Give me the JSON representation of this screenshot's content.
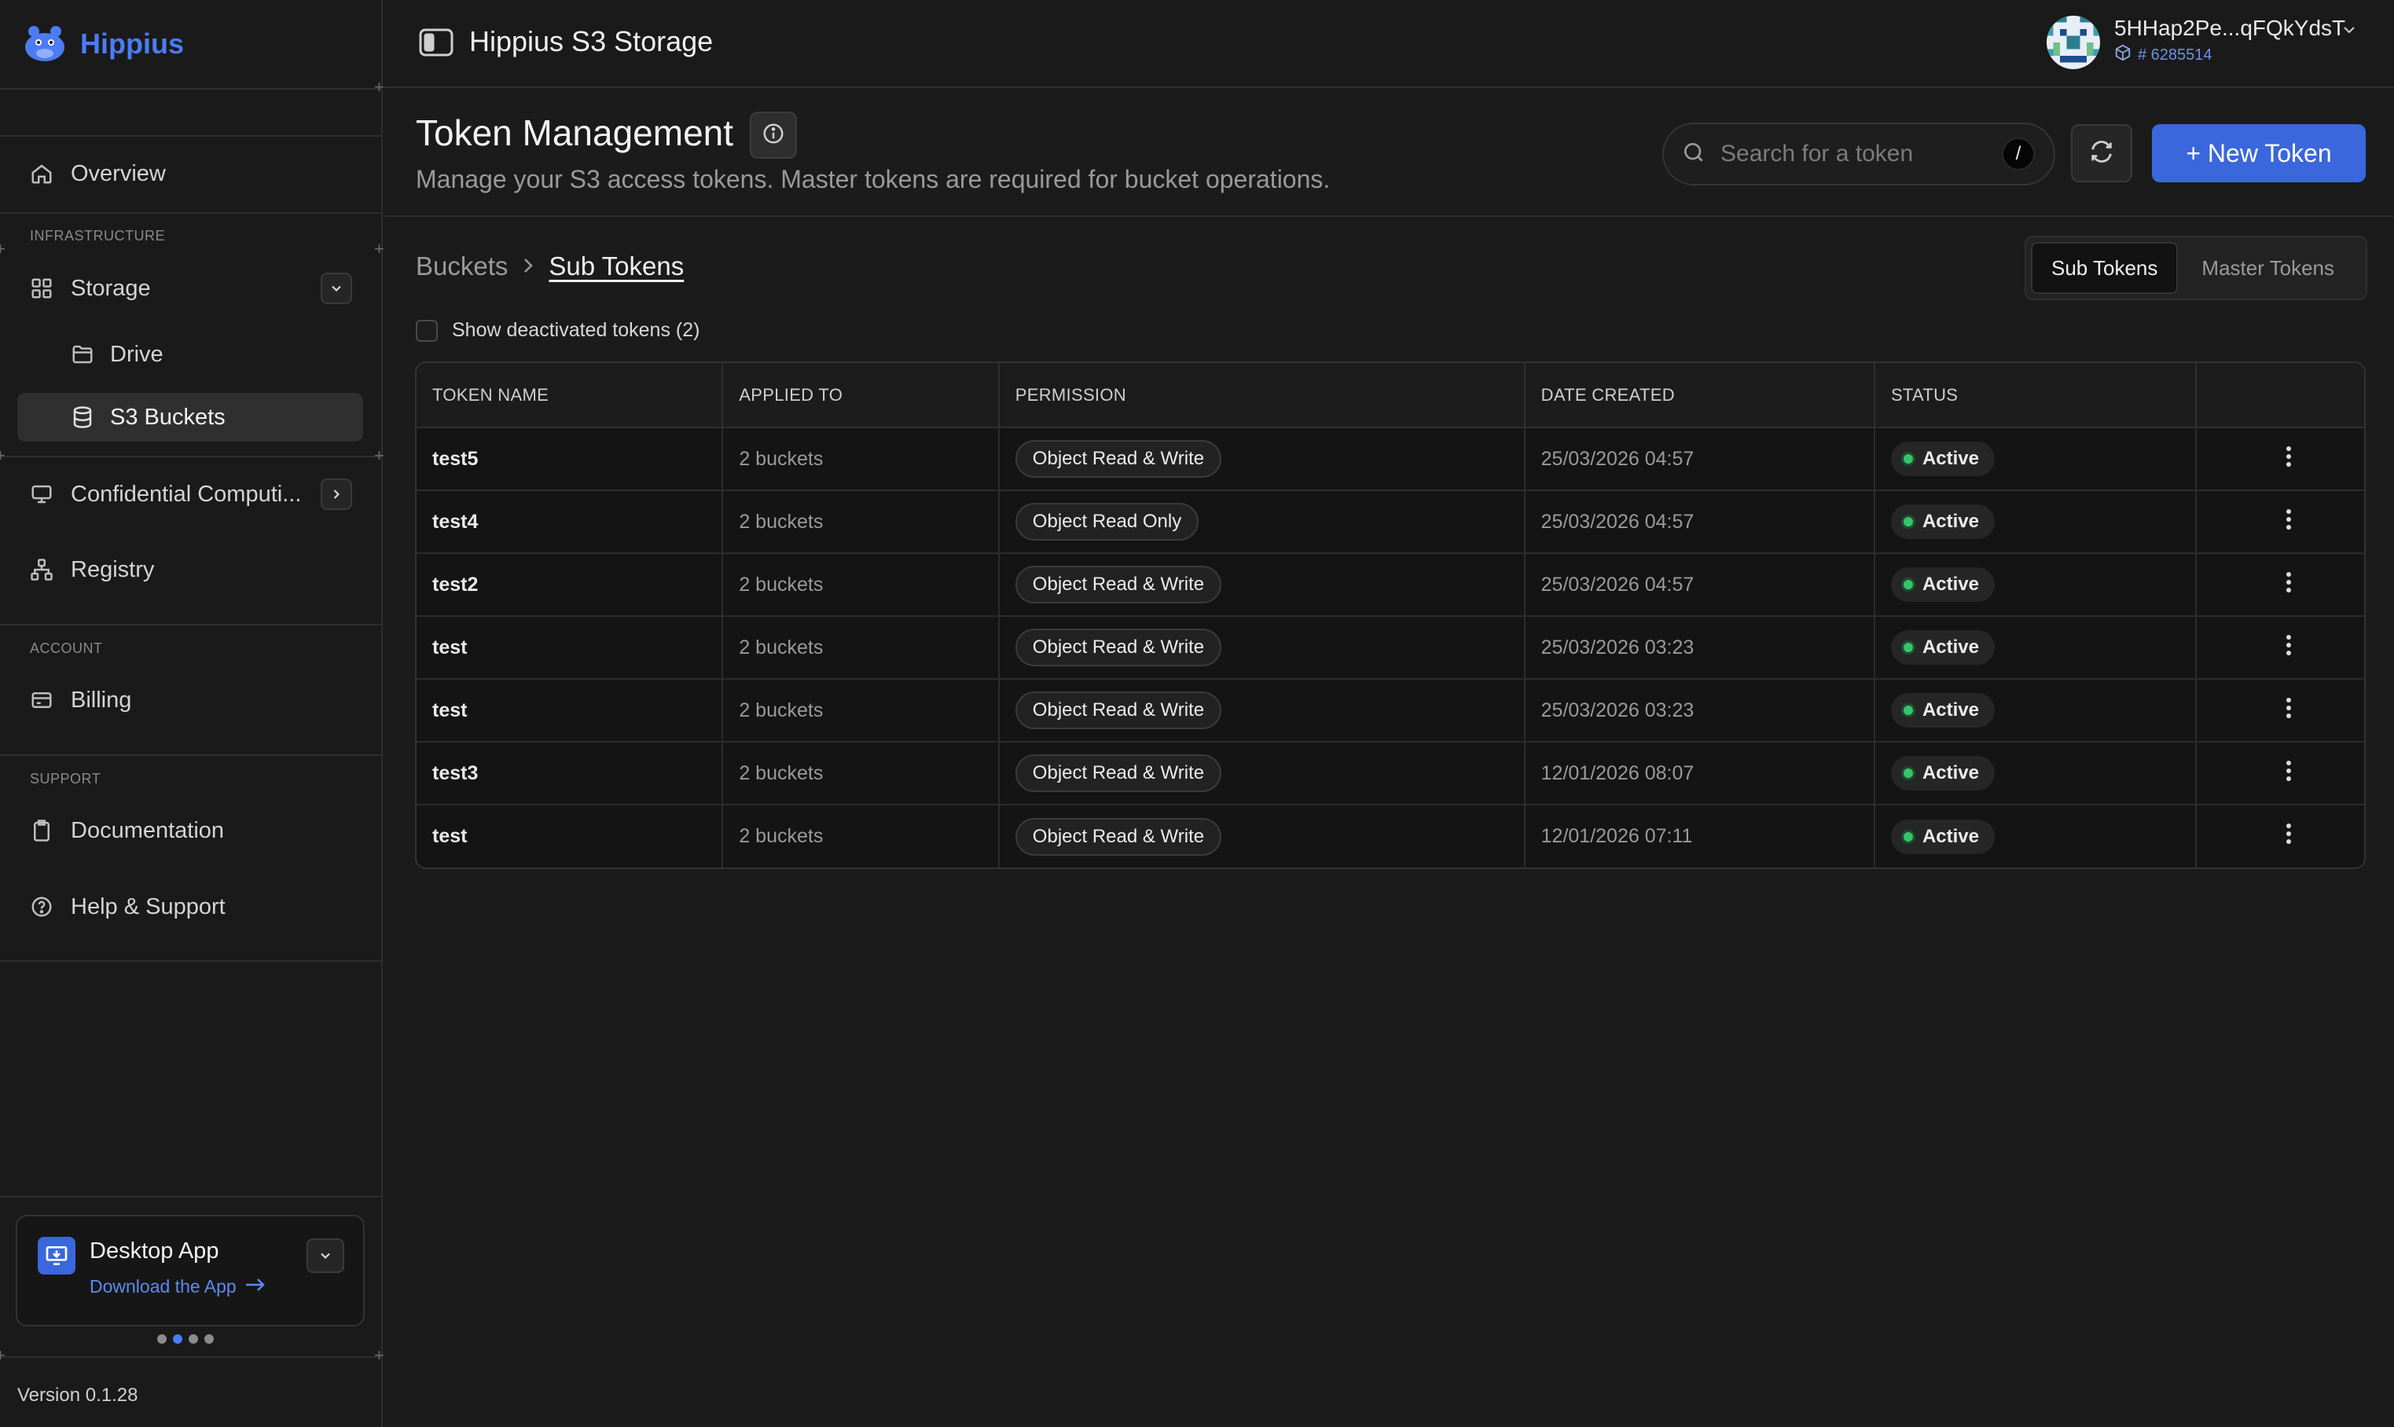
{
  "brand": {
    "name": "Hippius"
  },
  "sidebar": {
    "overview": "Overview",
    "sections": {
      "infrastructure": "INFRASTRUCTURE",
      "account": "ACCOUNT",
      "support": "SUPPORT"
    },
    "items": {
      "storage": "Storage",
      "drive": "Drive",
      "s3_buckets": "S3 Buckets",
      "confidential": "Confidential Computi...",
      "registry": "Registry",
      "billing": "Billing",
      "documentation": "Documentation",
      "help": "Help & Support"
    },
    "desktop_card": {
      "title": "Desktop App",
      "link": "Download the App"
    },
    "carousel": {
      "count": 4,
      "active_index": 1
    },
    "version": "Version 0.1.28"
  },
  "topbar": {
    "title": "Hippius S3 Storage",
    "user": {
      "address": "5HHap2Pe...qFQkYdsT",
      "id": "# 6285514"
    }
  },
  "header": {
    "title": "Token Management",
    "subtitle": "Manage your S3 access tokens. Master tokens are required for bucket operations.",
    "search_placeholder": "Search for a token",
    "search_shortcut": "/",
    "new_button": "+ New Token"
  },
  "breadcrumb": {
    "parent": "Buckets",
    "current": "Sub Tokens"
  },
  "tabs": {
    "sub": "Sub Tokens",
    "master": "Master Tokens",
    "active": "sub"
  },
  "filters": {
    "show_deactivated": "Show deactivated tokens (2)",
    "checked": false
  },
  "table": {
    "columns": {
      "name": "TOKEN NAME",
      "applied": "APPLIED TO",
      "permission": "PERMISSION",
      "date": "DATE CREATED",
      "status": "STATUS"
    },
    "rows": [
      {
        "name": "test5",
        "applied": "2 buckets",
        "permission": "Object Read & Write",
        "date": "25/03/2026 04:57",
        "status": "Active"
      },
      {
        "name": "test4",
        "applied": "2 buckets",
        "permission": "Object Read Only",
        "date": "25/03/2026 04:57",
        "status": "Active"
      },
      {
        "name": "test2",
        "applied": "2 buckets",
        "permission": "Object Read & Write",
        "date": "25/03/2026 04:57",
        "status": "Active"
      },
      {
        "name": "test",
        "applied": "2 buckets",
        "permission": "Object Read & Write",
        "date": "25/03/2026 03:23",
        "status": "Active"
      },
      {
        "name": "test",
        "applied": "2 buckets",
        "permission": "Object Read & Write",
        "date": "25/03/2026 03:23",
        "status": "Active"
      },
      {
        "name": "test3",
        "applied": "2 buckets",
        "permission": "Object Read & Write",
        "date": "12/01/2026 08:07",
        "status": "Active"
      },
      {
        "name": "test",
        "applied": "2 buckets",
        "permission": "Object Read & Write",
        "date": "12/01/2026 07:11",
        "status": "Active"
      }
    ]
  },
  "colors": {
    "accent": "#3a67dc",
    "brand": "#4b7cf2",
    "status_active": "#35c46a",
    "background": "#1b1b1b"
  },
  "icons": {
    "logo": "hippo-logo-icon",
    "overview": "home-icon",
    "storage": "grid-icon",
    "drive": "folder-icon",
    "s3": "database-icon",
    "confidential": "monitor-icon",
    "registry": "network-icon",
    "billing": "card-icon",
    "documentation": "clipboard-icon",
    "help": "help-circle-icon",
    "search": "search-icon",
    "refresh": "refresh-icon",
    "info": "info-icon",
    "row_menu": "kebab-icon"
  }
}
